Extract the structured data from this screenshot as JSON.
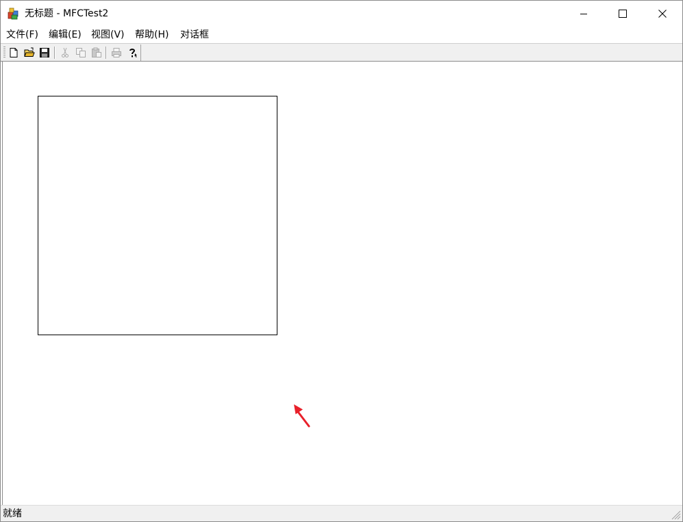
{
  "window": {
    "title": "无标题 - MFCTest2",
    "app_icon": "mfc-app-icon",
    "controls": {
      "minimize": "minimize-icon",
      "maximize": "maximize-icon",
      "close": "close-icon"
    }
  },
  "menubar": {
    "items": [
      {
        "label": "文件(F)"
      },
      {
        "label": "编辑(E)"
      },
      {
        "label": "视图(V)"
      },
      {
        "label": "帮助(H)"
      },
      {
        "label": "对话框"
      }
    ]
  },
  "toolbar": {
    "buttons": [
      {
        "icon": "new-file-icon",
        "enabled": true
      },
      {
        "icon": "open-folder-icon",
        "enabled": true
      },
      {
        "icon": "save-icon",
        "enabled": true
      },
      {
        "icon": "cut-icon",
        "enabled": false
      },
      {
        "icon": "copy-icon",
        "enabled": false
      },
      {
        "icon": "paste-icon",
        "enabled": false
      },
      {
        "icon": "print-icon",
        "enabled": false
      },
      {
        "icon": "help-icon",
        "enabled": true
      }
    ]
  },
  "canvas": {
    "shape": "rectangle",
    "annotation": "red-arrow-icon",
    "annotation_color": "#e8202a"
  },
  "statusbar": {
    "text": "就绪"
  }
}
